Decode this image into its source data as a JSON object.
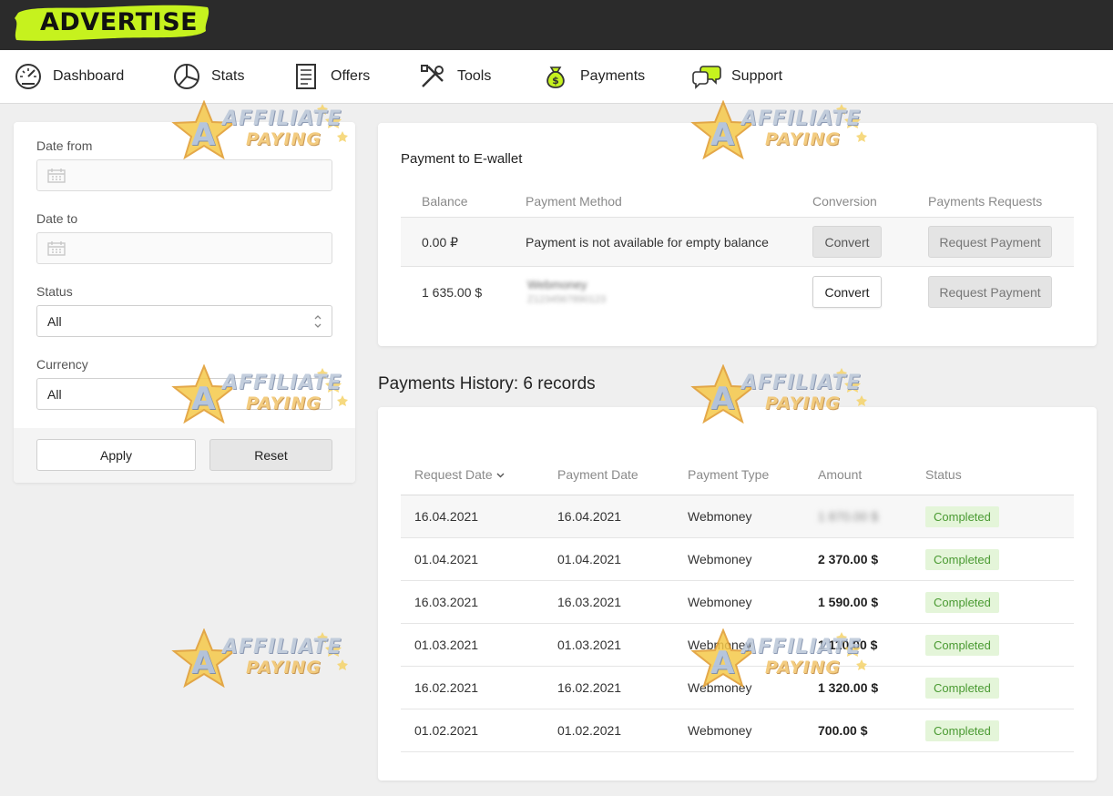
{
  "app": {
    "logo_text": "ADVERTISE"
  },
  "nav": {
    "items": [
      {
        "label": "Dashboard",
        "icon": "gauge-icon"
      },
      {
        "label": "Stats",
        "icon": "pie-chart-icon"
      },
      {
        "label": "Offers",
        "icon": "document-icon"
      },
      {
        "label": "Tools",
        "icon": "tools-icon"
      },
      {
        "label": "Payments",
        "icon": "money-bag-icon"
      },
      {
        "label": "Support",
        "icon": "chat-bubbles-icon"
      }
    ]
  },
  "filter": {
    "date_from_label": "Date from",
    "date_to_label": "Date to",
    "status_label": "Status",
    "status_value": "All",
    "currency_label": "Currency",
    "currency_value": "All",
    "apply_label": "Apply",
    "reset_label": "Reset"
  },
  "wallet": {
    "title": "Payment to E-wallet",
    "columns": [
      "Balance",
      "Payment Method",
      "Conversion",
      "Payments Requests"
    ],
    "rows": [
      {
        "balance": "0.00 ₽",
        "method": "Payment is not available for empty balance",
        "convert_label": "Convert",
        "convert_enabled": false,
        "request_label": "Request Payment"
      },
      {
        "balance": "1 635.00 $",
        "method": "Webmoney",
        "method_sub": "Z1234567890123",
        "convert_label": "Convert",
        "convert_enabled": true,
        "request_label": "Request Payment"
      }
    ]
  },
  "history": {
    "title": "Payments History: 6 records",
    "columns": [
      "Request Date",
      "Payment Date",
      "Payment Type",
      "Amount",
      "Status"
    ],
    "rows": [
      {
        "request_date": "16.04.2021",
        "payment_date": "16.04.2021",
        "type": "Webmoney",
        "amount": "1 870.00 $",
        "amount_blurred": true,
        "status": "Completed"
      },
      {
        "request_date": "01.04.2021",
        "payment_date": "01.04.2021",
        "type": "Webmoney",
        "amount": "2 370.00 $",
        "amount_blurred": false,
        "status": "Completed"
      },
      {
        "request_date": "16.03.2021",
        "payment_date": "16.03.2021",
        "type": "Webmoney",
        "amount": "1 590.00 $",
        "amount_blurred": false,
        "status": "Completed"
      },
      {
        "request_date": "01.03.2021",
        "payment_date": "01.03.2021",
        "type": "Webmoney",
        "amount": "1 110.00 $",
        "amount_blurred": false,
        "status": "Completed"
      },
      {
        "request_date": "16.02.2021",
        "payment_date": "16.02.2021",
        "type": "Webmoney",
        "amount": "1 320.00 $",
        "amount_blurred": false,
        "status": "Completed"
      },
      {
        "request_date": "01.02.2021",
        "payment_date": "01.02.2021",
        "type": "Webmoney",
        "amount": "700.00 $",
        "amount_blurred": false,
        "status": "Completed"
      }
    ]
  },
  "watermark": {
    "line1": "AFFILIATE",
    "line2": "PAYING",
    "letter": "A"
  },
  "colors": {
    "brand": "#c6f21e",
    "topbar": "#2b2b2b",
    "status_completed": "#4a9a32",
    "status_completed_bg": "#e4f5d9"
  }
}
